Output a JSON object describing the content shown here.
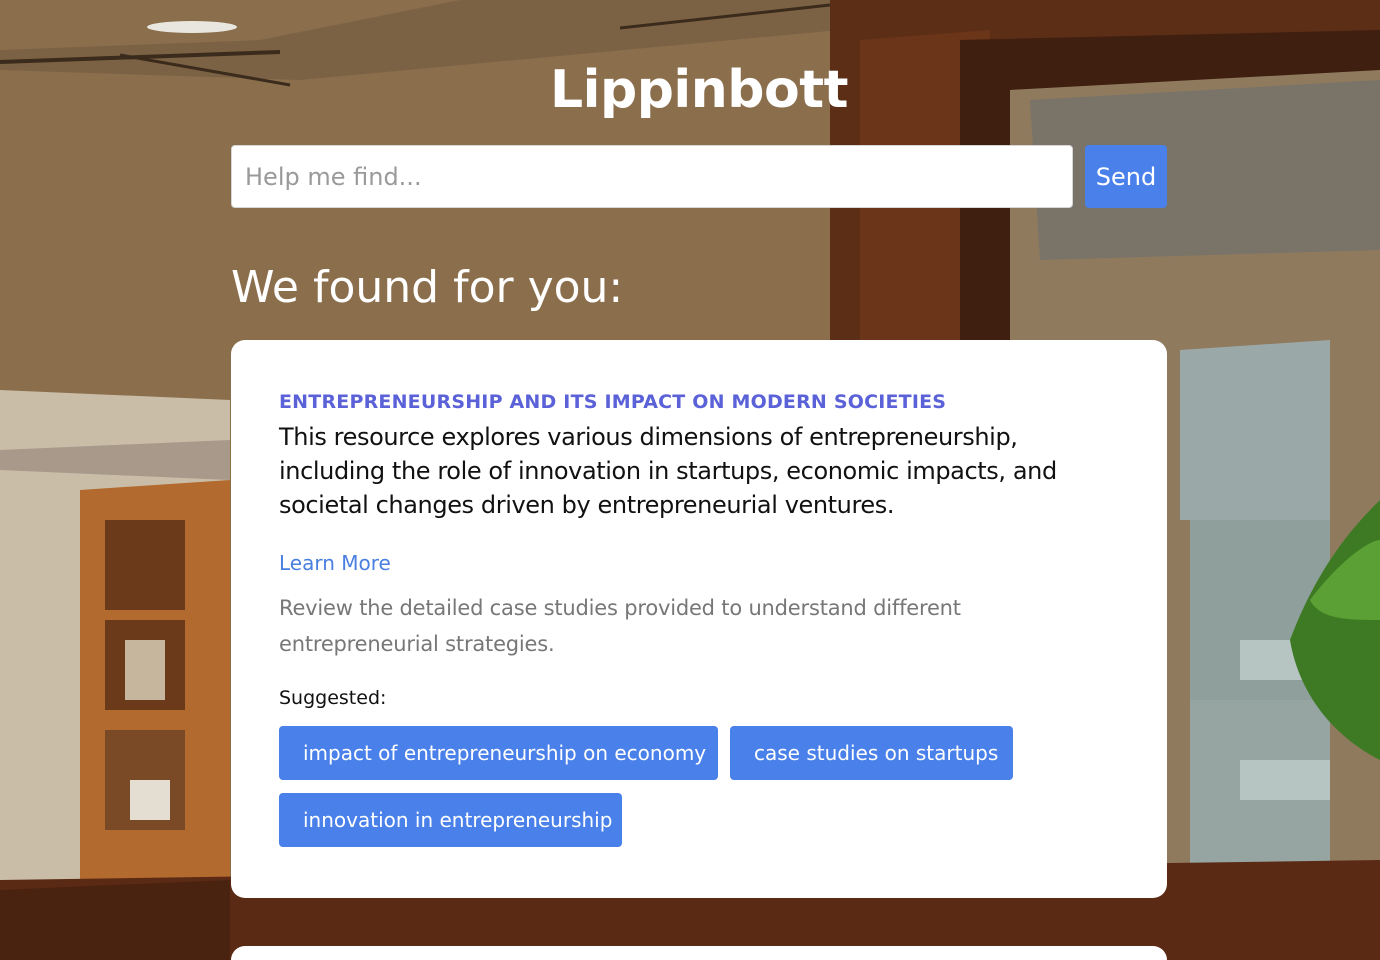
{
  "app": {
    "title": "Lippinbott"
  },
  "search": {
    "placeholder": "Help me find...",
    "value": "",
    "send_label": "Send"
  },
  "results": {
    "heading": "We found for you:",
    "card": {
      "kicker": "ENTREPRENEURSHIP AND ITS IMPACT ON MODERN SOCIETIES",
      "description": "This resource explores various dimensions of entrepreneurship, including the role of innovation in startups, economic impacts, and societal changes driven by entrepreneurial ventures.",
      "link_label": "Learn More",
      "note": "Review the detailed case studies provided to understand different entrepreneurial strategies.",
      "suggested_label": "Suggested:",
      "suggestions": [
        "impact of entrepreneurship on economy",
        "case studies on startups",
        "innovation in entrepreneurship"
      ]
    }
  },
  "colors": {
    "accent": "#4a80ea",
    "kicker": "#5b62d8",
    "link": "#4a7fe0",
    "background": "#8a6e4c"
  }
}
